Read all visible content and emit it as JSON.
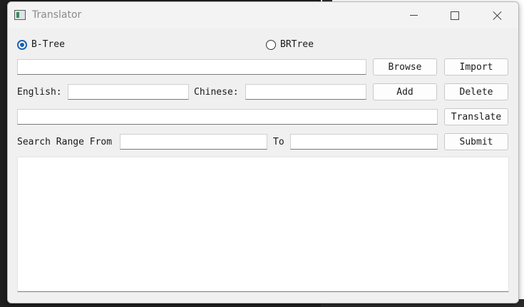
{
  "window": {
    "title": "Translator"
  },
  "modes": [
    {
      "label": "B-Tree",
      "checked": true
    },
    {
      "label": "BRTree",
      "checked": false
    }
  ],
  "file": {
    "path_value": "",
    "browse_label": "Browse",
    "import_label": "Import"
  },
  "entry": {
    "english_label": "English:",
    "english_value": "",
    "chinese_label": "Chinese:",
    "chinese_value": "",
    "add_label": "Add",
    "delete_label": "Delete"
  },
  "translate": {
    "input_value": "",
    "button_label": "Translate"
  },
  "range": {
    "from_label": "Search Range From",
    "from_value": "",
    "to_label": "To",
    "to_value": "",
    "submit_label": "Submit"
  },
  "output": {
    "text": ""
  },
  "colors": {
    "accent": "#1a5fb4",
    "window_bg": "#f0f0f0"
  }
}
